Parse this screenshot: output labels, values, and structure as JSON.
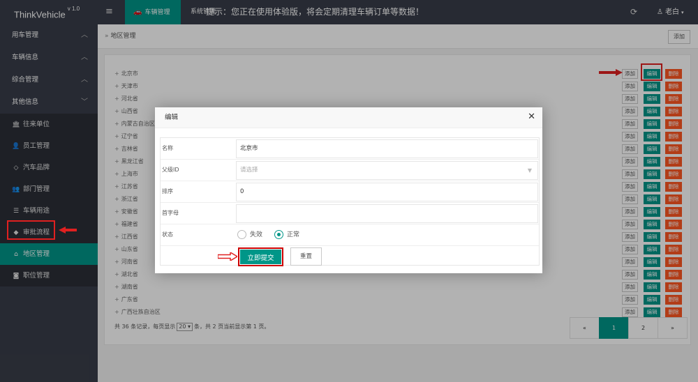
{
  "header": {
    "logo": "ThinkVehicle",
    "version": "v 1.0",
    "menu_icon": "≡",
    "top_tab": "车辆管理",
    "system_label": "系统管理",
    "notice": "提示：您正在使用体验版，将会定期清理车辆订单等数据！",
    "user": "老白"
  },
  "sidebar": {
    "groups": [
      "用车管理",
      "车辆信息",
      "综合管理",
      "其他信息"
    ],
    "items": [
      {
        "label": "往来单位",
        "icon": "bank-icon"
      },
      {
        "label": "员工管理",
        "icon": "user-icon"
      },
      {
        "label": "汽车品牌",
        "icon": "diamond-icon"
      },
      {
        "label": "部门管理",
        "icon": "users-icon"
      },
      {
        "label": "车辆用途",
        "icon": "sliders-icon"
      },
      {
        "label": "审批流程",
        "icon": "android-icon"
      },
      {
        "label": "地区管理",
        "icon": "home-icon",
        "active": true
      },
      {
        "label": "职位管理",
        "icon": "camera-icon"
      }
    ]
  },
  "main": {
    "breadcrumb": "地区管理",
    "add_button": "添加",
    "row_actions": {
      "add": "添加",
      "edit": "编辑",
      "delete": "删除"
    },
    "regions": [
      "北京市",
      "天津市",
      "河北省",
      "山西省",
      "内蒙古自治区",
      "辽宁省",
      "吉林省",
      "黑龙江省",
      "上海市",
      "江苏省",
      "浙江省",
      "安徽省",
      "福建省",
      "江西省",
      "山东省",
      "河南省",
      "湖北省",
      "湖南省",
      "广东省",
      "广西壮族自治区"
    ],
    "footer": {
      "prefix": "共 36 条记录，每页显示",
      "page_size": "20",
      "suffix": "条，共 2 页当前显示第 1 页。"
    },
    "pagination": [
      "«",
      "1",
      "2",
      "»"
    ]
  },
  "modal": {
    "title": "编辑",
    "fields": {
      "name_label": "名称",
      "name_value": "北京市",
      "parent_label": "父级ID",
      "parent_placeholder": "请选择",
      "sort_label": "排序",
      "sort_value": "0",
      "initial_label": "首字母",
      "initial_value": "",
      "status_label": "状态",
      "status_options": [
        "失效",
        "正常"
      ],
      "status_selected": "正常"
    },
    "submit": "立即提交",
    "reset": "重置"
  },
  "colors": {
    "accent": "#009688",
    "danger": "#ff5722",
    "header": "#393d49",
    "highlight": "#e02020"
  }
}
